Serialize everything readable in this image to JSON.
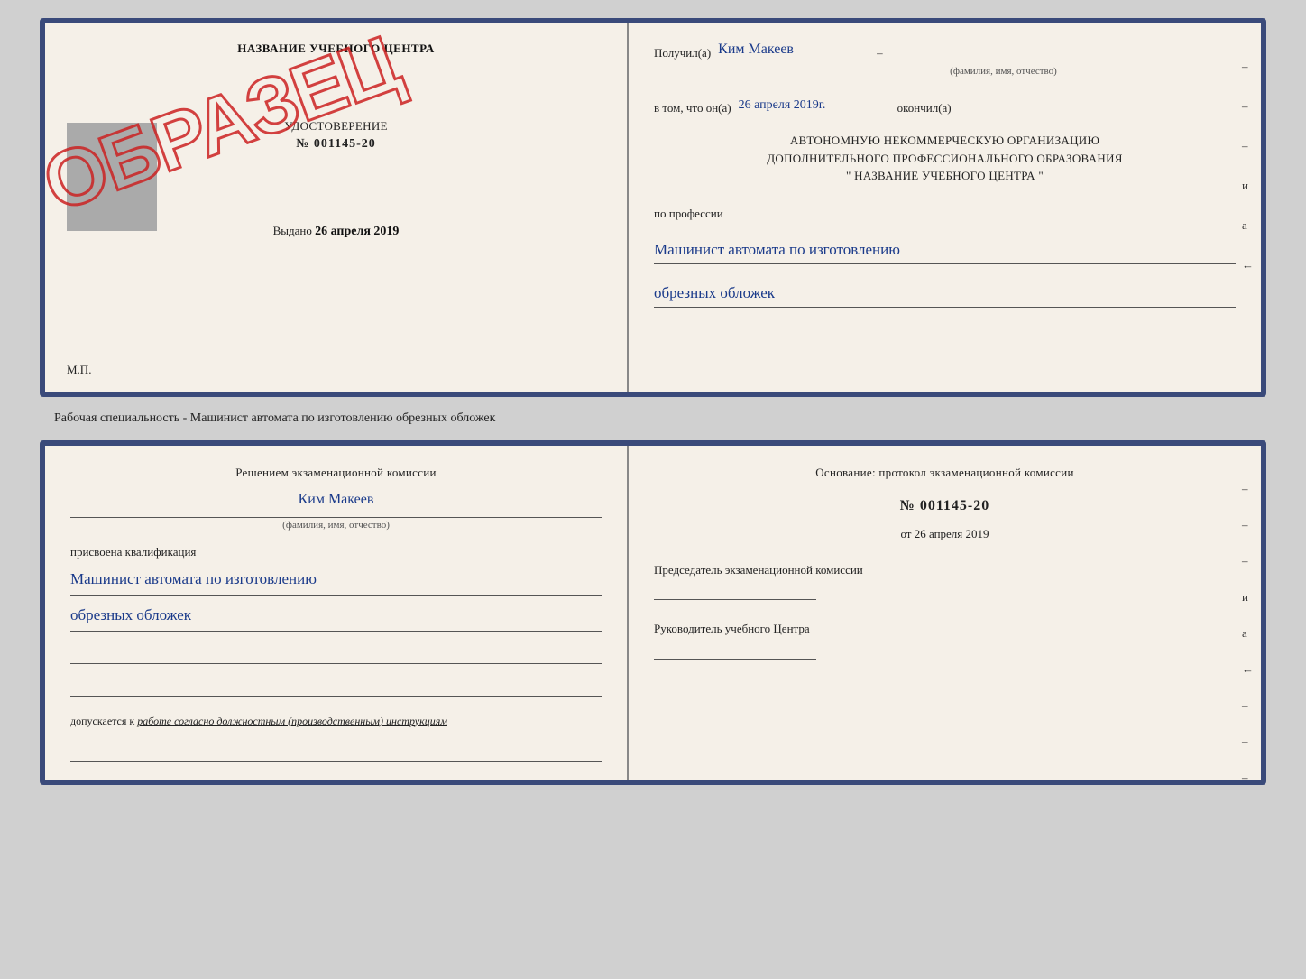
{
  "page": {
    "background": "#d0d0d0"
  },
  "top_document": {
    "left": {
      "school_name": "НАЗВАНИЕ УЧЕБНОГО ЦЕНТРА",
      "watermark": "ОБРАЗЕЦ",
      "cert_title": "УДОСТОВЕРЕНИЕ",
      "cert_number": "№ 001145-20",
      "issued_label": "Выдано",
      "issued_date": "26 апреля 2019",
      "mp_label": "М.П."
    },
    "right": {
      "received_label": "Получил(а)",
      "name_value": "Ким Макеев",
      "fio_subtitle": "(фамилия, имя, отчество)",
      "date_label": "в том, что он(а)",
      "date_value": "26 апреля 2019г.",
      "finished_label": "окончил(а)",
      "org_line1": "АВТОНОМНУЮ НЕКОММЕРЧЕСКУЮ ОРГАНИЗАЦИЮ",
      "org_line2": "ДОПОЛНИТЕЛЬНОГО ПРОФЕССИОНАЛЬНОГО ОБРАЗОВАНИЯ",
      "org_line3": "\"   НАЗВАНИЕ УЧЕБНОГО ЦЕНТРА   \"",
      "profession_label": "по профессии",
      "profession_line1": "Машинист автомата по изготовлению",
      "profession_line2": "обрезных обложек",
      "dash1": "–",
      "dash2": "–",
      "dash3": "–",
      "и_label": "и",
      "а_label": "а",
      "left_arrow": "←"
    }
  },
  "middle_text": "Рабочая специальность - Машинист автомата по изготовлению обрезных обложек",
  "bottom_document": {
    "left": {
      "decision_text": "Решением экзаменационной комиссии",
      "name_value": "Ким Макеев",
      "fio_label": "(фамилия, имя, отчество)",
      "qual_label": "присвоена квалификация",
      "qual_line1": "Машинист автомата по изготовлению",
      "qual_line2": "обрезных обложек",
      "допускается_label": "допускается к",
      "допускается_value": "работе согласно должностным (производственным) инструкциям"
    },
    "right": {
      "osnование_text": "Основание: протокол экзаменационной комиссии",
      "protocol_number": "№ 001145-20",
      "date_label": "от",
      "date_value": "26 апреля 2019",
      "chairman_label": "Председатель экзаменационной комиссии",
      "director_label": "Руководитель учебного Центра",
      "dash1": "–",
      "dash2": "–",
      "dash3": "–",
      "и_label": "и",
      "а_label": "а",
      "left_arrow": "←",
      "dash4": "–",
      "dash5": "–",
      "dash6": "–"
    }
  }
}
